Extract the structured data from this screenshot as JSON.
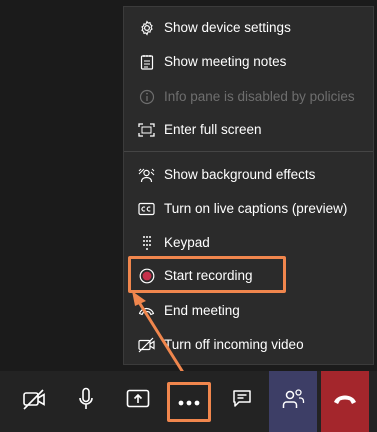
{
  "menu": {
    "items": [
      {
        "label": "Show device settings",
        "icon": "gear-icon",
        "disabled": false
      },
      {
        "label": "Show meeting notes",
        "icon": "notes-icon",
        "disabled": false
      },
      {
        "label": "Info pane is disabled by policies",
        "icon": "info-icon",
        "disabled": true
      },
      {
        "label": "Enter full screen",
        "icon": "fullscreen-icon",
        "disabled": false
      },
      {
        "label": "Show background effects",
        "icon": "background-effects-icon",
        "disabled": false
      },
      {
        "label": "Turn on live captions (preview)",
        "icon": "captions-icon",
        "disabled": false
      },
      {
        "label": "Keypad",
        "icon": "keypad-icon",
        "disabled": false
      },
      {
        "label": "Start recording",
        "icon": "record-icon",
        "disabled": false,
        "highlighted": true
      },
      {
        "label": "End meeting",
        "icon": "end-call-icon",
        "disabled": false
      },
      {
        "label": "Turn off incoming video",
        "icon": "video-off-icon",
        "disabled": false
      }
    ]
  },
  "toolbar": {
    "buttons": [
      {
        "name": "camera-off-button",
        "icon": "camera-off-icon"
      },
      {
        "name": "microphone-button",
        "icon": "microphone-icon"
      },
      {
        "name": "share-screen-button",
        "icon": "share-icon"
      },
      {
        "name": "more-actions-button",
        "icon": "more-icon",
        "highlighted": true
      },
      {
        "name": "chat-button",
        "icon": "chat-icon"
      },
      {
        "name": "participants-button",
        "icon": "participants-icon"
      },
      {
        "name": "hang-up-button",
        "icon": "hang-up-icon"
      }
    ]
  },
  "colors": {
    "highlight": "#f0864d",
    "menu_bg": "#2b2b2b",
    "toolbar_bg": "#232323",
    "participants_bg": "#3d3e66",
    "hangup_bg": "#a4262c",
    "record": "#c4314b"
  }
}
